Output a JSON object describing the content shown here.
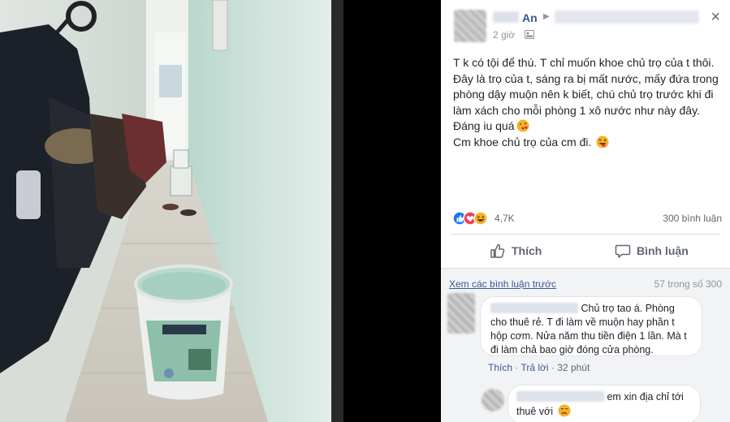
{
  "post": {
    "author": "An",
    "time": "2 giờ",
    "close_glyph": "×",
    "body_lines": [
      "T k có tội để thú. T chỉ muốn khoe chủ trọ của t thôi.",
      "Đây là trọ của t, sáng ra bị mất nước, mấy đứa trong phòng dậy muộn nên k biết, chú chủ trọ trước khi đi làm xách cho mỗi phòng 1 xô nước như này đây.",
      "Đáng iu quá",
      "Cm khoe chủ trọ của cm đi."
    ],
    "reaction_count": "4,7K",
    "comment_count": "300 bình luận",
    "actions": {
      "like": "Thích",
      "comment": "Bình luận"
    }
  },
  "comments": {
    "view_previous": "Xem các bình luận trước",
    "paging": "57 trong số 300",
    "items": [
      {
        "text": "Chủ trọ tao á. Phòng cho thuê rẻ. T đi làm về muộn hay phần t hộp cơm. Nửa năm thu tiền điện 1 lần. Mà t đi làm chả bao giờ đóng cửa phòng.",
        "like": "Thích",
        "reply": "Trả lời",
        "time": "32 phút"
      },
      {
        "text": "em xin địa chỉ tới thuê với"
      }
    ]
  },
  "colors": {
    "link": "#365899",
    "text": "#1d2129",
    "muted": "#90949c",
    "like_blue": "#1877f2",
    "love_red": "#f33e58",
    "haha_yellow": "#f7b125"
  },
  "icons": [
    "globe-audience-icon",
    "close-icon",
    "like-reaction-icon",
    "love-reaction-icon",
    "haha-reaction-icon",
    "thumb-up-icon",
    "comment-bubble-icon",
    "kiss-emoji-icon",
    "tongue-wink-emoji-icon",
    "crying-emoji-icon"
  ]
}
